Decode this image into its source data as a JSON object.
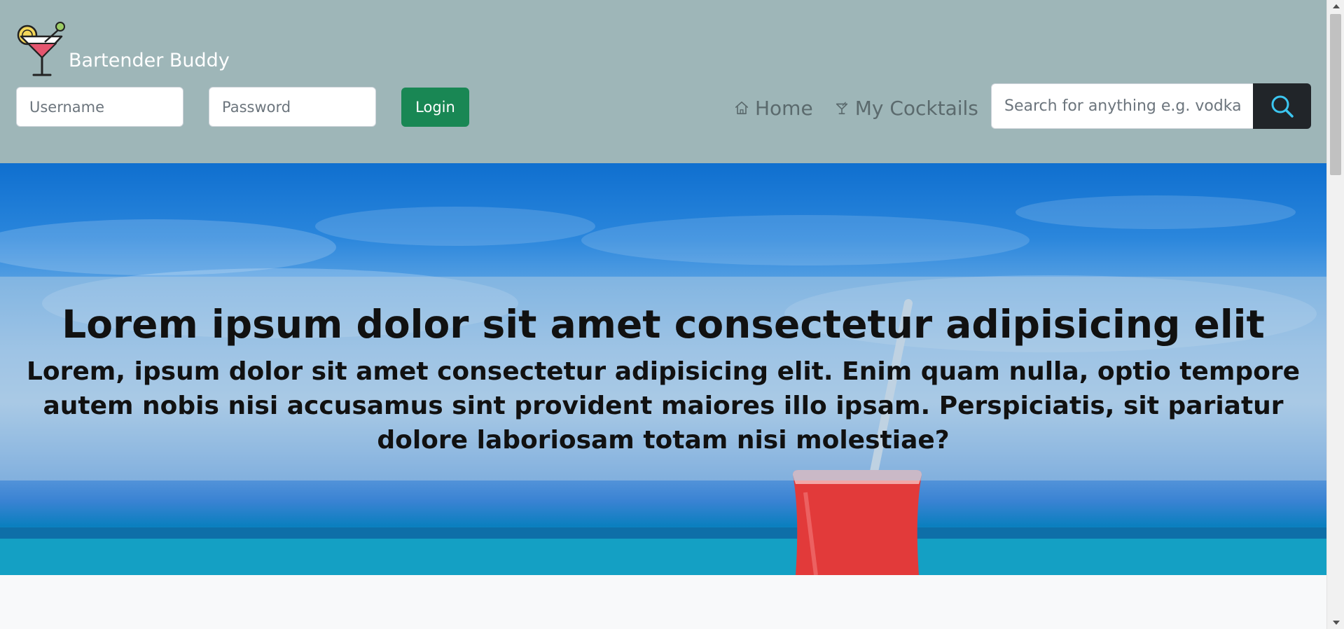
{
  "brand": {
    "name": "Bartender Buddy",
    "logo_icon": "cocktail-glass-icon"
  },
  "login": {
    "username_placeholder": "Username",
    "username_value": "",
    "password_placeholder": "Password",
    "password_value": "",
    "button_label": "Login"
  },
  "nav": {
    "items": [
      {
        "label": "Home",
        "icon": "home-icon"
      },
      {
        "label": "My Cocktails",
        "icon": "cocktail-icon"
      }
    ]
  },
  "search": {
    "placeholder": "Search for anything e.g. vodka",
    "value": "",
    "button_icon": "search-icon"
  },
  "hero": {
    "title": "Lorem ipsum dolor sit amet consectetur adipisicing elit",
    "text": "Lorem, ipsum dolor sit amet consectetur adipisicing elit. Enim quam nulla, optio tempore autem nobis nisi accusamus sint provident maiores illo ipsam. Perspiciatis, sit pariatur dolore laboriosam totam nisi molestiae?"
  },
  "colors": {
    "header_bg": "#9eb6b8",
    "login_button": "#198754",
    "search_button": "#212529",
    "search_icon": "#3cc6f0",
    "nav_text": "#5b6a6d"
  }
}
